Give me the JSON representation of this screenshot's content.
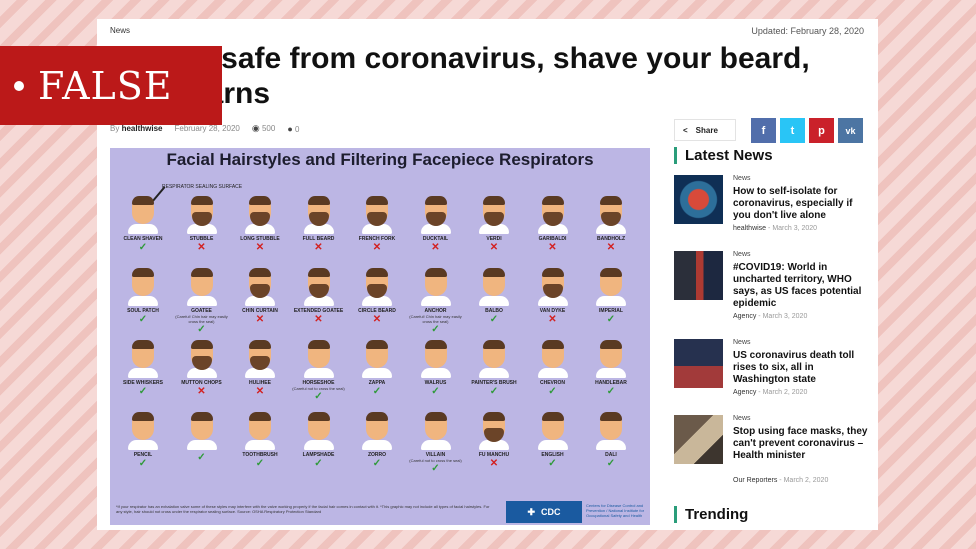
{
  "article": {
    "category": "News",
    "updated": "Updated: February 28, 2020",
    "title": "To stay safe from coronavirus, shave your beard, CDC warns",
    "byline_prefix": "By",
    "author": "healthwise",
    "date": "February 28, 2020",
    "views": "500",
    "comments": "0"
  },
  "verdict": {
    "label": "FALSE"
  },
  "infographic": {
    "title": "Facial Hairstyles and Filtering Facepiece Respirators",
    "seal_label": "RESPIRATOR SEALING SURFACE",
    "cells": [
      {
        "label": "CLEAN SHAVEN",
        "ok": true,
        "beard": false,
        "note": ""
      },
      {
        "label": "STUBBLE",
        "ok": false,
        "beard": true,
        "note": ""
      },
      {
        "label": "LONG STUBBLE",
        "ok": false,
        "beard": true,
        "note": ""
      },
      {
        "label": "FULL BEARD",
        "ok": false,
        "beard": true,
        "note": ""
      },
      {
        "label": "FRENCH FORK",
        "ok": false,
        "beard": true,
        "note": ""
      },
      {
        "label": "DUCKTAIL",
        "ok": false,
        "beard": true,
        "note": ""
      },
      {
        "label": "VERDI",
        "ok": false,
        "beard": true,
        "note": ""
      },
      {
        "label": "GARIBALDI",
        "ok": false,
        "beard": true,
        "note": ""
      },
      {
        "label": "BANDHOLZ",
        "ok": false,
        "beard": true,
        "note": ""
      },
      {
        "label": "SOUL PATCH",
        "ok": true,
        "beard": false,
        "note": ""
      },
      {
        "label": "GOATEE",
        "ok": true,
        "beard": false,
        "note": "(Careful! Chin hair may easily cross the seal)"
      },
      {
        "label": "CHIN CURTAIN",
        "ok": false,
        "beard": true,
        "note": ""
      },
      {
        "label": "EXTENDED GOATEE",
        "ok": false,
        "beard": true,
        "note": ""
      },
      {
        "label": "CIRCLE BEARD",
        "ok": false,
        "beard": true,
        "note": ""
      },
      {
        "label": "ANCHOR",
        "ok": true,
        "beard": false,
        "note": "(Careful! Chin hair may easily cross the seal)"
      },
      {
        "label": "BALBO",
        "ok": true,
        "beard": false,
        "note": ""
      },
      {
        "label": "VAN DYKE",
        "ok": false,
        "beard": true,
        "note": ""
      },
      {
        "label": "IMPERIAL",
        "ok": true,
        "beard": false,
        "note": ""
      },
      {
        "label": "SIDE WHISKERS",
        "ok": true,
        "beard": false,
        "note": ""
      },
      {
        "label": "MUTTON CHOPS",
        "ok": false,
        "beard": true,
        "note": ""
      },
      {
        "label": "HULIHEE",
        "ok": false,
        "beard": true,
        "note": ""
      },
      {
        "label": "HORSESHOE",
        "ok": true,
        "beard": false,
        "note": "(Careful not to cross the seal)"
      },
      {
        "label": "ZAPPA",
        "ok": true,
        "beard": false,
        "note": ""
      },
      {
        "label": "WALRUS",
        "ok": true,
        "beard": false,
        "note": ""
      },
      {
        "label": "PAINTER'S BRUSH",
        "ok": true,
        "beard": false,
        "note": ""
      },
      {
        "label": "CHEVRON",
        "ok": true,
        "beard": false,
        "note": ""
      },
      {
        "label": "HANDLEBAR",
        "ok": true,
        "beard": false,
        "note": ""
      },
      {
        "label": "PENCIL",
        "ok": true,
        "beard": false,
        "note": ""
      },
      {
        "label": "",
        "ok": true,
        "beard": false,
        "note": ""
      },
      {
        "label": "TOOTHBRUSH",
        "ok": true,
        "beard": false,
        "note": ""
      },
      {
        "label": "LAMPSHADE",
        "ok": true,
        "beard": false,
        "note": ""
      },
      {
        "label": "ZORRO",
        "ok": true,
        "beard": false,
        "note": ""
      },
      {
        "label": "VILLAIN",
        "ok": true,
        "beard": false,
        "note": "(Careful not to cross the seal)"
      },
      {
        "label": "FU MANCHU",
        "ok": false,
        "beard": true,
        "note": ""
      },
      {
        "label": "ENGLISH",
        "ok": true,
        "beard": false,
        "note": ""
      },
      {
        "label": "DALI",
        "ok": true,
        "beard": false,
        "note": ""
      }
    ],
    "footnote": "*If your respirator has an exhalation valve some of these styles may interfere with the valve working properly if the facial hair comes in contact with it. *This graphic may not include all types of facial hairstyles. For any style, hair should not cross under the respirator sealing surface. Source: OSHA Respiratory Protection Standard",
    "logo_text": "CDC",
    "logo_caption": "Centers for Disease Control and Prevention / National Institute for Occupational Safety and Health"
  },
  "share": {
    "label": "Share",
    "buttons": [
      {
        "name": "facebook",
        "glyph": "f"
      },
      {
        "name": "twitter",
        "glyph": "t"
      },
      {
        "name": "pinterest",
        "glyph": "p"
      },
      {
        "name": "vk",
        "glyph": "vk"
      }
    ]
  },
  "sidebar": {
    "latest_heading": "Latest News",
    "trending_heading": "Trending",
    "items": [
      {
        "category": "News",
        "title": "How to self-isolate for coronavirus, especially if you don't live alone",
        "author": "healthwise",
        "date": "March 3, 2020"
      },
      {
        "category": "News",
        "title": "#COVID19: World in uncharted territory, WHO says, as US faces potential epidemic",
        "author": "Agency",
        "date": "March 3, 2020"
      },
      {
        "category": "News",
        "title": "US coronavirus death toll rises to six, all in Washington state",
        "author": "Agency",
        "date": "March 2, 2020"
      },
      {
        "category": "News",
        "title": "Stop using face masks, they can't prevent coronavirus –Health minister",
        "author": "Our Reporters",
        "date": "March 2, 2020"
      }
    ]
  },
  "colors": {
    "verdict_red": "#bb1919",
    "accent_green": "#2a9d7a",
    "ok_green": "#2f9a3a",
    "no_red": "#d32020",
    "infographic_bg": "#bcb6e4"
  }
}
